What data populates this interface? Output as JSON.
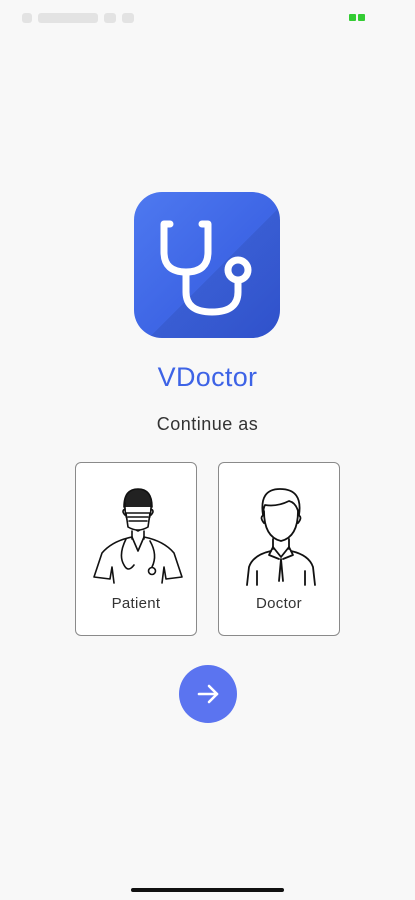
{
  "app": {
    "name": "VDoctor",
    "logo_icon": "stethoscope-icon",
    "accent_color": "#3d63e6"
  },
  "prompt": {
    "text": "Continue as"
  },
  "roles": [
    {
      "label": "Patient",
      "icon": "masked-doctor-illustration"
    },
    {
      "label": "Doctor",
      "icon": "person-illustration"
    }
  ],
  "next_button": {
    "icon": "arrow-right-icon",
    "color": "#5b74f0"
  }
}
